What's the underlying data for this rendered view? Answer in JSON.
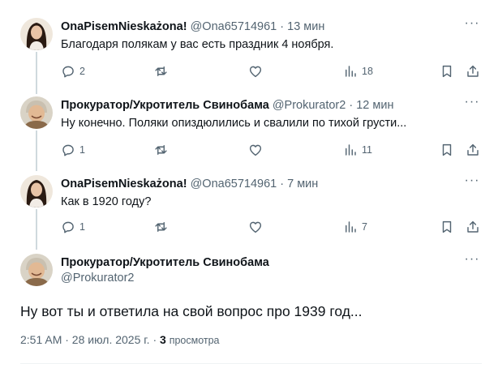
{
  "replies": [
    {
      "name": "OnaPisemNieskażona!",
      "handle": "@Ona65714961",
      "dot": "·",
      "time": "13 мин",
      "text": "Благодаря полякам у вас есть праздник 4 ноября.",
      "replies_count": "2",
      "retweets_count": "",
      "likes_count": "",
      "views_count": "18",
      "avatar": "woman-dark-hair"
    },
    {
      "name": "Прокуратор/Укротитель Свинобама",
      "handle": "@Prokurator2",
      "dot": "·",
      "time": "12 мин",
      "text": "Ну конечно. Поляки опиздюлились и свалили по тихой грусти...",
      "replies_count": "1",
      "retweets_count": "",
      "likes_count": "",
      "views_count": "11",
      "avatar": "elderly-woman-smiling"
    },
    {
      "name": "OnaPisemNieskażona!",
      "handle": "@Ona65714961",
      "dot": "·",
      "time": "7 мин",
      "text": "Как в 1920 году?",
      "replies_count": "1",
      "retweets_count": "",
      "likes_count": "",
      "views_count": "7",
      "avatar": "woman-dark-hair"
    }
  ],
  "main_tweet": {
    "name": "Прокуратор/Укротитель Свинобама",
    "handle": "@Prokurator2",
    "text": "Ну вот ты и ответила на свой вопрос про 1939 год...",
    "timestamp": "2:51 AM · 28 июл. 2025 г. ·",
    "views_count": "3",
    "views_label": "просмотра"
  },
  "more_glyph": "···",
  "colors": {
    "text": "#0f1419",
    "secondary": "#536471",
    "thread_line": "#cfd9de"
  }
}
